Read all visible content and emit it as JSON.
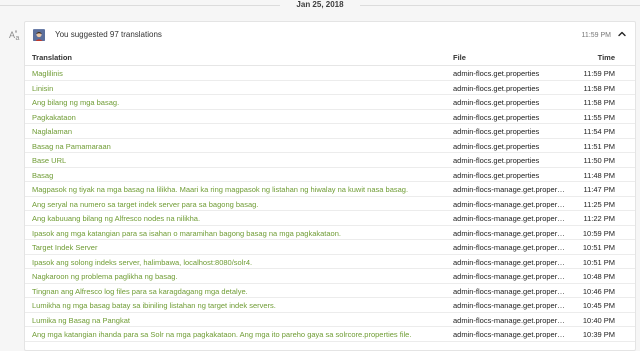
{
  "date_header": "Jan 25, 2018",
  "activity": {
    "summary": "You suggested 97 translations",
    "time": "11:59 PM",
    "icon": "translate-icon",
    "collapse_icon": "chevron-up-icon"
  },
  "table": {
    "headers": {
      "translation": "Translation",
      "file": "File",
      "time": "Time"
    },
    "rows": [
      {
        "translation": "Maglilinis",
        "file": "admin-flocs.get.properties",
        "time": "11:59 PM"
      },
      {
        "translation": "Linisin",
        "file": "admin-flocs.get.properties",
        "time": "11:58 PM"
      },
      {
        "translation": "Ang bilang ng mga basag.",
        "file": "admin-flocs.get.properties",
        "time": "11:58 PM"
      },
      {
        "translation": "Pagkakataon",
        "file": "admin-flocs.get.properties",
        "time": "11:55 PM"
      },
      {
        "translation": "Naglalaman",
        "file": "admin-flocs.get.properties",
        "time": "11:54 PM"
      },
      {
        "translation": "Basag na Pamamaraan",
        "file": "admin-flocs.get.properties",
        "time": "11:51 PM"
      },
      {
        "translation": "Base URL",
        "file": "admin-flocs.get.properties",
        "time": "11:50 PM"
      },
      {
        "translation": "Basag",
        "file": "admin-flocs.get.properties",
        "time": "11:48 PM"
      },
      {
        "translation": "Magpasok ng tiyak na mga basag na lilikha. Maari ka ring magpasok ng listahan ng hiwalay na kuwit nasa basag.",
        "file": "admin-flocs-manage.get.properties",
        "time": "11:47 PM"
      },
      {
        "translation": "Ang seryal na numero sa target indek server para sa bagong basag.",
        "file": "admin-flocs-manage.get.properties",
        "time": "11:25 PM"
      },
      {
        "translation": "Ang kabuuang bilang ng Alfresco nodes na nilikha.",
        "file": "admin-flocs-manage.get.properties",
        "time": "11:22 PM"
      },
      {
        "translation": "Ipasok ang mga katangian para sa isahan o maramihan bagong basag na mga pagkakataon.",
        "file": "admin-flocs-manage.get.properties",
        "time": "10:59 PM"
      },
      {
        "translation": "Target Indek Server",
        "file": "admin-flocs-manage.get.properties",
        "time": "10:51 PM"
      },
      {
        "translation": "Ipasok ang solong indeks server, halimbawa, localhost:8080/solr4.",
        "file": "admin-flocs-manage.get.properties",
        "time": "10:51 PM"
      },
      {
        "translation": "Nagkaroon ng problema paglikha ng basag.",
        "file": "admin-flocs-manage.get.properties",
        "time": "10:48 PM"
      },
      {
        "translation": "Tingnan ang Alfresco log files para sa karagdagang mga detalye.",
        "file": "admin-flocs-manage.get.properties",
        "time": "10:46 PM"
      },
      {
        "translation": "Lumikha ng mga basag batay sa ibiniling listahan ng target indek servers.",
        "file": "admin-flocs-manage.get.properties",
        "time": "10:45 PM"
      },
      {
        "translation": "Lumika ng Basag na Pangkat",
        "file": "admin-flocs-manage.get.properties",
        "time": "10:40 PM"
      },
      {
        "translation": "Ang mga katangian ihanda para sa Solr na mga pagkakataon. Ang mga ito pareho gaya sa solrcore.properties file.",
        "file": "admin-flocs-manage.get.properties",
        "time": "10:39 PM"
      }
    ]
  }
}
